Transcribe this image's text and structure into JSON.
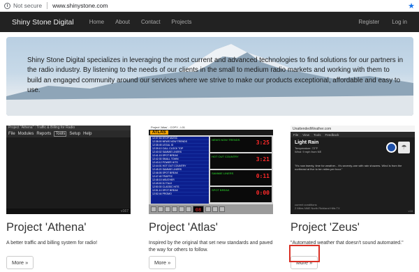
{
  "browser": {
    "security": "Not secure",
    "url": "www.shinystone.com"
  },
  "nav": {
    "brand": "Shiny Stone Digital",
    "links": [
      "Home",
      "About",
      "Contact",
      "Projects"
    ],
    "register": "Register",
    "login": "Log in"
  },
  "hero": {
    "text": "Shiny Stone Digital specializes in leveraging the most current and advanced technologies to find solutions for our partners in the radio industry. By listening to the needs of our clients in the small to medium radio markets and working with them to build an engaged community around our services where we strive to make our products exceptional, affordable and easy to use."
  },
  "projects": [
    {
      "title": "Project 'Athena'",
      "desc": "A better traffic and billing system for radio!",
      "button": "More »",
      "shot": {
        "window_title": "Project \"Athena\" : Traffic & Billing for Radio",
        "menu": [
          "File",
          "Modules",
          "Reports",
          "Tools",
          "Setup",
          "Help"
        ],
        "version": "v167"
      }
    },
    {
      "title": "Project 'Atlas'",
      "desc": "Inspired by the original that set new standards and paved the way for others to follow.",
      "button": "More »",
      "shot": {
        "window_title": "Project 'Atlas' - COPY - L01",
        "logo": "ATLAS",
        "rows": [
          "12:37:53 STOP MUSIC",
          "12:38:00 NEWS NOW TRENDS",
          "12:38:45 LEGAL ID",
          "12:39:10 CALL CLOCK TOP",
          "12:40:02 SAMMIE LINERS",
          "12:41:15 SPOT BREAK",
          "12:42:30 SMALL TOWN",
          "12:43:12 POWER HITS",
          "12:44:01 HOT OUT COUNTRY",
          "12:45:20 SAMMIE LINERS",
          "12:46:05 SPOT BREAK",
          "12:47:40 TRAFFIC",
          "12:48:15 WEATHER",
          "12:49:00 DJ TALK",
          "12:50:30 CLASSIC HITS",
          "12:51:10 SPOT BREAK",
          "12:52:44 PROMO"
        ],
        "panels": [
          {
            "label": "NEWS NOW TRENDS",
            "clock": "3:25"
          },
          {
            "label": "HOT OUT COUNTRY",
            "clock": "3:21"
          },
          {
            "label": "SAMMIE LINERS",
            "clock": "0:11"
          },
          {
            "label": "SPOT BREAK",
            "clock": "0:00"
          }
        ],
        "counter": "08"
      }
    },
    {
      "title": "Project 'Zeus'",
      "desc": "\"Automated weather that doesn't sound automated.\"",
      "button": "More »",
      "shot": {
        "window_title": "UnattendedWeather.com",
        "menu": [
          "File",
          "View",
          "Tools",
          "Feedback"
        ],
        "condition": "Light Rain",
        "temp": "Temperature: 72°F",
        "wind": "Wind: 9 mph from NE",
        "forecast": "\"It's now twenty, time for weather... It's seventy-one with rain showers. Wind is from the northeast at five to ten miles per hour.\"",
        "current_label": "current conditions",
        "location": "2 Miles NNE North Richland Hills TX",
        "version": "v18"
      }
    }
  ]
}
